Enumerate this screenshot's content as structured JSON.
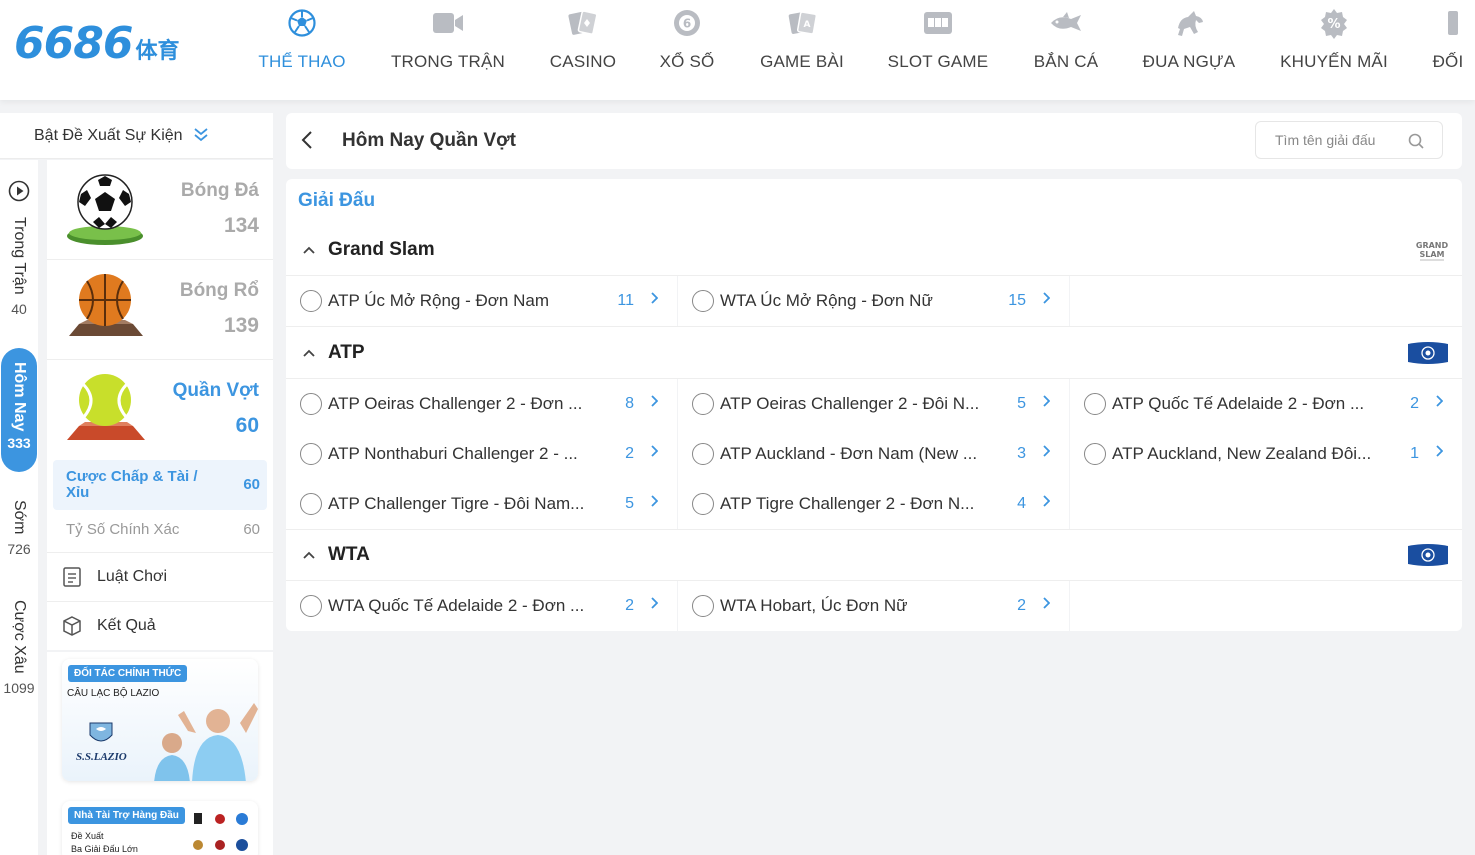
{
  "brand": {
    "logo_num": "6686",
    "logo_cn": "体育"
  },
  "nav": [
    {
      "label": "THỂ THAO",
      "icon": "soccer-ball-icon",
      "active": true
    },
    {
      "label": "TRONG TRẬN",
      "icon": "video-camera-icon"
    },
    {
      "label": "CASINO",
      "icon": "cards-icon"
    },
    {
      "label": "XỔ SỐ",
      "icon": "lottery-ball-icon"
    },
    {
      "label": "GAME BÀI",
      "icon": "card-game-icon"
    },
    {
      "label": "SLOT GAME",
      "icon": "slot-machine-icon"
    },
    {
      "label": "BẮN CÁ",
      "icon": "fish-icon"
    },
    {
      "label": "ĐUA NGỰA",
      "icon": "horse-icon"
    },
    {
      "label": "KHUYẾN MÃI",
      "icon": "percent-gear-icon"
    },
    {
      "label": "ĐỐI",
      "icon": "partner-icon"
    }
  ],
  "suggest_label": "Bật Đề Xuất Sự Kiện",
  "rail": {
    "live": {
      "label": "Trong Trận",
      "count": "40"
    },
    "today": {
      "label": "Hôm Nay",
      "count": "333"
    },
    "early": {
      "label": "Sớm",
      "count": "726"
    },
    "parlay": {
      "label": "Cược Xâu",
      "count": "1099"
    }
  },
  "sports": [
    {
      "name": "Bóng Đá",
      "count": "134",
      "icon": "soccer-ball-icon"
    },
    {
      "name": "Bóng Rổ",
      "count": "139",
      "icon": "basketball-icon"
    },
    {
      "name": "Quần Vợt",
      "count": "60",
      "icon": "tennis-ball-icon",
      "active": true
    }
  ],
  "sub_bets": [
    {
      "label": "Cược Chấp & Tài / Xỉu",
      "count": "60",
      "active": true
    },
    {
      "label": "Tỷ Số Chính Xác",
      "count": "60"
    }
  ],
  "menu": {
    "rules": "Luật Chơi",
    "results": "Kết Quả"
  },
  "promo": {
    "badge": "ĐỐI TÁC CHÍNH THỨC",
    "club": "CÂU LẠC BỘ LAZIO",
    "brand": "S.S.LAZIO",
    "badge2": "Nhà Tài Trợ Hàng Đầu",
    "line1": "Đề Xuất",
    "line2": "Ba Giải Đấu Lớn"
  },
  "header": {
    "title": "Hôm Nay Quần Vợt",
    "search_placeholder": "Tìm tên giải đấu"
  },
  "content_title": "Giải Đấu",
  "groups": [
    {
      "name": "Grand Slam",
      "logo": "grand-slam-logo",
      "leagues": [
        {
          "name": "ATP Úc Mở Rộng - Đơn Nam",
          "count": "11"
        },
        {
          "name": "WTA Úc Mở Rộng - Đơn Nữ",
          "count": "15"
        }
      ]
    },
    {
      "name": "ATP",
      "logo": "atp-flag-logo",
      "leagues": [
        {
          "name": "ATP Oeiras Challenger 2 - Đơn ...",
          "count": "8"
        },
        {
          "name": "ATP Oeiras Challenger 2 - Đôi N...",
          "count": "5"
        },
        {
          "name": "ATP Quốc Tế Adelaide 2 - Đơn ...",
          "count": "2"
        },
        {
          "name": "ATP Nonthaburi Challenger 2 - ...",
          "count": "2"
        },
        {
          "name": "ATP Auckland - Đơn Nam (New ...",
          "count": "3"
        },
        {
          "name": "ATP Auckland, New Zealand Đôi...",
          "count": "1"
        },
        {
          "name": "ATP Challenger Tigre - Đôi Nam...",
          "count": "5"
        },
        {
          "name": "ATP Tigre Challenger 2 - Đơn N...",
          "count": "4"
        }
      ]
    },
    {
      "name": "WTA",
      "logo": "wta-flag-logo",
      "leagues": [
        {
          "name": "WTA Quốc Tế Adelaide 2 - Đơn ...",
          "count": "2"
        },
        {
          "name": "WTA Hobart, Úc Đơn Nữ",
          "count": "2"
        }
      ]
    }
  ],
  "colors": {
    "accent": "#3c95e0",
    "brand": "#2e8fdc",
    "bg": "#f2f3f5"
  }
}
